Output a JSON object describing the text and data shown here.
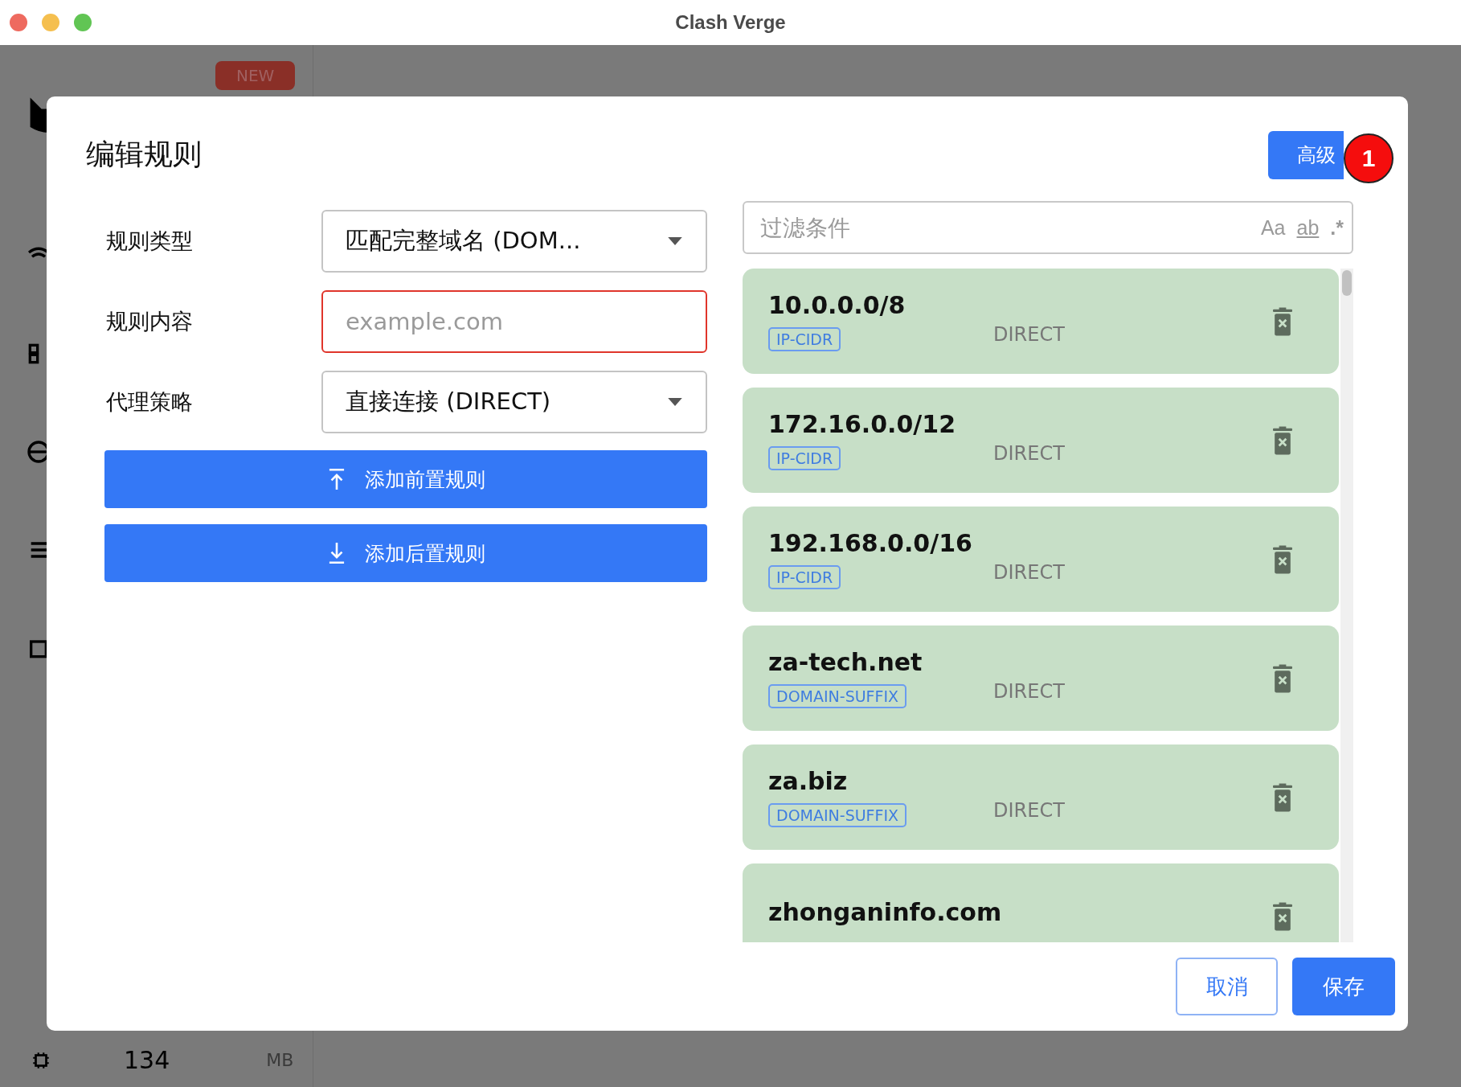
{
  "window": {
    "title": "Clash Verge"
  },
  "background": {
    "badge": "NEW",
    "memory_value": "134",
    "memory_unit": "MB"
  },
  "dialog": {
    "title": "编辑规则",
    "advanced_button": "高级",
    "badge": "1",
    "form": [
      {
        "kind": "select",
        "label": "规则类型",
        "value": "匹配完整域名 (DOM...",
        "error": false
      },
      {
        "kind": "input",
        "label": "规则内容",
        "placeholder": "example.com",
        "error": true
      },
      {
        "kind": "select",
        "label": "代理策略",
        "value": "直接连接 (DIRECT)",
        "error": false
      }
    ],
    "actions": [
      {
        "kind": "prepend",
        "label": "添加前置规则"
      },
      {
        "kind": "append",
        "label": "添加后置规则"
      }
    ],
    "filter": {
      "placeholder": "过滤条件",
      "options": [
        "Aa",
        "ab",
        ".*"
      ]
    },
    "rules": [
      {
        "name": "10.0.0.0/8",
        "type": "IP-CIDR",
        "policy": "DIRECT"
      },
      {
        "name": "172.16.0.0/12",
        "type": "IP-CIDR",
        "policy": "DIRECT"
      },
      {
        "name": "192.168.0.0/16",
        "type": "IP-CIDR",
        "policy": "DIRECT"
      },
      {
        "name": "za-tech.net",
        "type": "DOMAIN-SUFFIX",
        "policy": "DIRECT"
      },
      {
        "name": "za.biz",
        "type": "DOMAIN-SUFFIX",
        "policy": "DIRECT"
      },
      {
        "name": "zhonganinfo.com"
      }
    ],
    "buttons": {
      "cancel": "取消",
      "save": "保存"
    }
  }
}
